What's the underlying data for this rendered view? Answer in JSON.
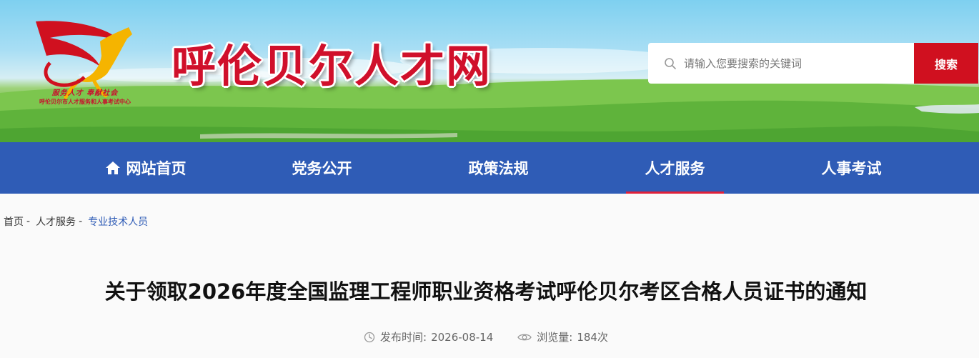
{
  "header": {
    "site_title": "呼伦贝尔人才网",
    "logo_caption_line1": "服务人才 奉献社会",
    "logo_caption_line2": "呼伦贝尔市人才服务和人事考试中心"
  },
  "search": {
    "placeholder": "请输入您要搜索的关键词",
    "button_label": "搜索"
  },
  "nav": {
    "items": [
      {
        "label": "网站首页",
        "icon": "home-icon"
      },
      {
        "label": "党务公开"
      },
      {
        "label": "政策法规"
      },
      {
        "label": "人才服务",
        "active": true
      },
      {
        "label": "人事考试"
      }
    ]
  },
  "breadcrumb": {
    "items": [
      "首页",
      "人才服务",
      "专业技术人员"
    ],
    "separator": "-"
  },
  "article": {
    "title": "关于领取2026年度全国监理工程师职业资格考试呼伦贝尔考区合格人员证书的通知",
    "publish_label": "发布时间:",
    "publish_date": "2026-08-14",
    "views_label": "浏览量:",
    "views_count": "184次"
  },
  "colors": {
    "brand_red": "#d0101f",
    "nav_blue": "#2f5cb6",
    "active_underline": "#e0203a"
  }
}
